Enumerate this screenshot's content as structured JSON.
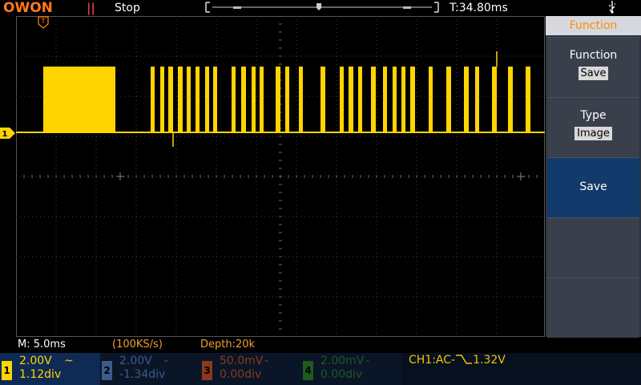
{
  "topbar": {
    "logo": "OWON",
    "run_icon": "pause-icon",
    "run_state": "Stop",
    "timebase": "T:34.80ms",
    "usb_icon": "usb-icon"
  },
  "colors": {
    "ch1": "#ffd400",
    "ch2": "#3d5a8a",
    "ch3": "#8a3a1a",
    "ch4": "#1e5a1e",
    "accent": "#ff8c00"
  },
  "bottom_info": {
    "horizontal": "M: 5.0ms",
    "sample_rate": "(100KS/s)",
    "depth": "Depth:20k"
  },
  "channels": [
    {
      "num": "1",
      "volts": "2.00V",
      "coupling": "~",
      "offset": "1.12div"
    },
    {
      "num": "2",
      "volts": "2.00V",
      "coupling": "-",
      "offset": "-1.34div"
    },
    {
      "num": "3",
      "volts": "50.0mV",
      "coupling": "-",
      "offset": "0.00div"
    },
    {
      "num": "4",
      "volts": "2.00mV",
      "coupling": "-",
      "offset": "0.00div"
    }
  ],
  "trigger": {
    "source": "CH1:AC-",
    "edge_icon": "falling-edge-icon",
    "level": "1.32V"
  },
  "panel": {
    "title": "Function",
    "buttons": [
      {
        "label": "Function",
        "value": "Save"
      },
      {
        "label": "Type",
        "value": "Image"
      },
      {
        "label": "Save",
        "value": ""
      },
      {
        "label": "",
        "value": ""
      },
      {
        "label": "",
        "value": ""
      }
    ]
  }
}
